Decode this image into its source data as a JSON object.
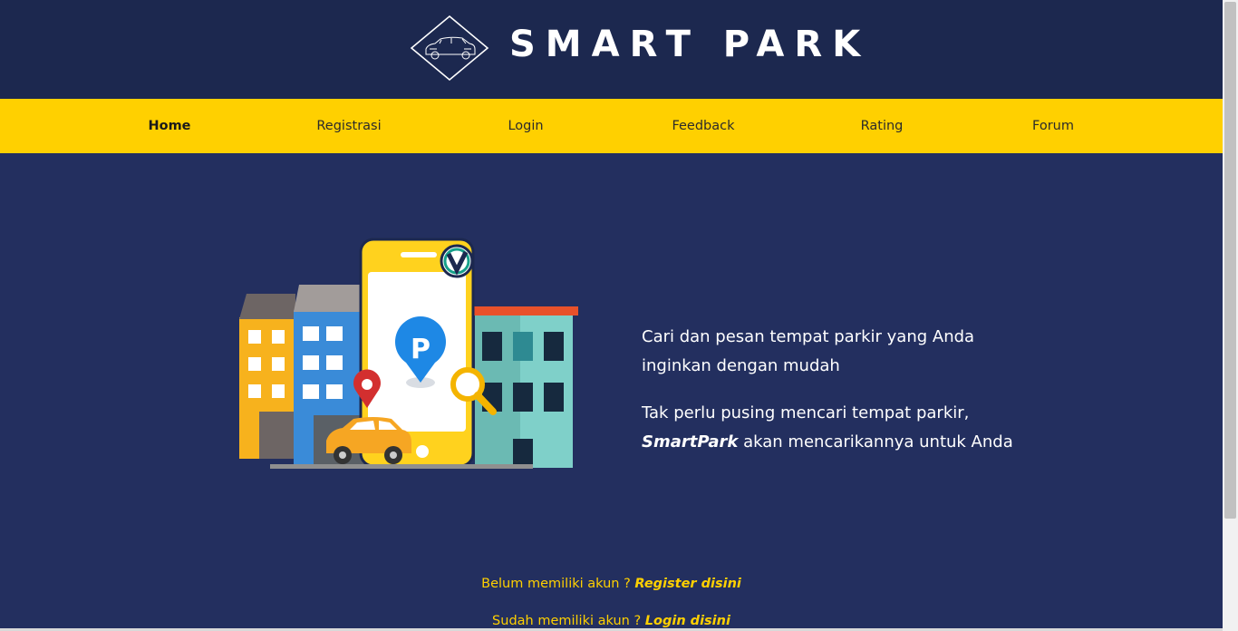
{
  "header": {
    "brand": "SMART PARK",
    "logo_icon": "car-diamond-logo",
    "background": "#1c284f"
  },
  "nav": {
    "background": "#ffd000",
    "items": [
      {
        "label": "Home",
        "active": true
      },
      {
        "label": "Registrasi",
        "active": false
      },
      {
        "label": "Login",
        "active": false
      },
      {
        "label": "Feedback",
        "active": false
      },
      {
        "label": "Rating",
        "active": false
      },
      {
        "label": "Forum",
        "active": false
      }
    ]
  },
  "hero": {
    "illustration": "city-parking-phone-illustration",
    "line1": "Cari dan pesan tempat parkir yang Anda inginkan dengan mudah",
    "line2_prefix": "Tak perlu pusing mencari tempat parkir,",
    "line2_brand": "SmartPark",
    "line2_suffix": "akan mencarikannya untuk Anda"
  },
  "cta": {
    "register_text": "Belum memiliki akun ?",
    "register_link": "Register disini",
    "login_text": "Sudah memiliki akun ?",
    "login_link": "Login disini"
  },
  "colors": {
    "page_bg": "#232f5f",
    "accent": "#ffd000"
  }
}
